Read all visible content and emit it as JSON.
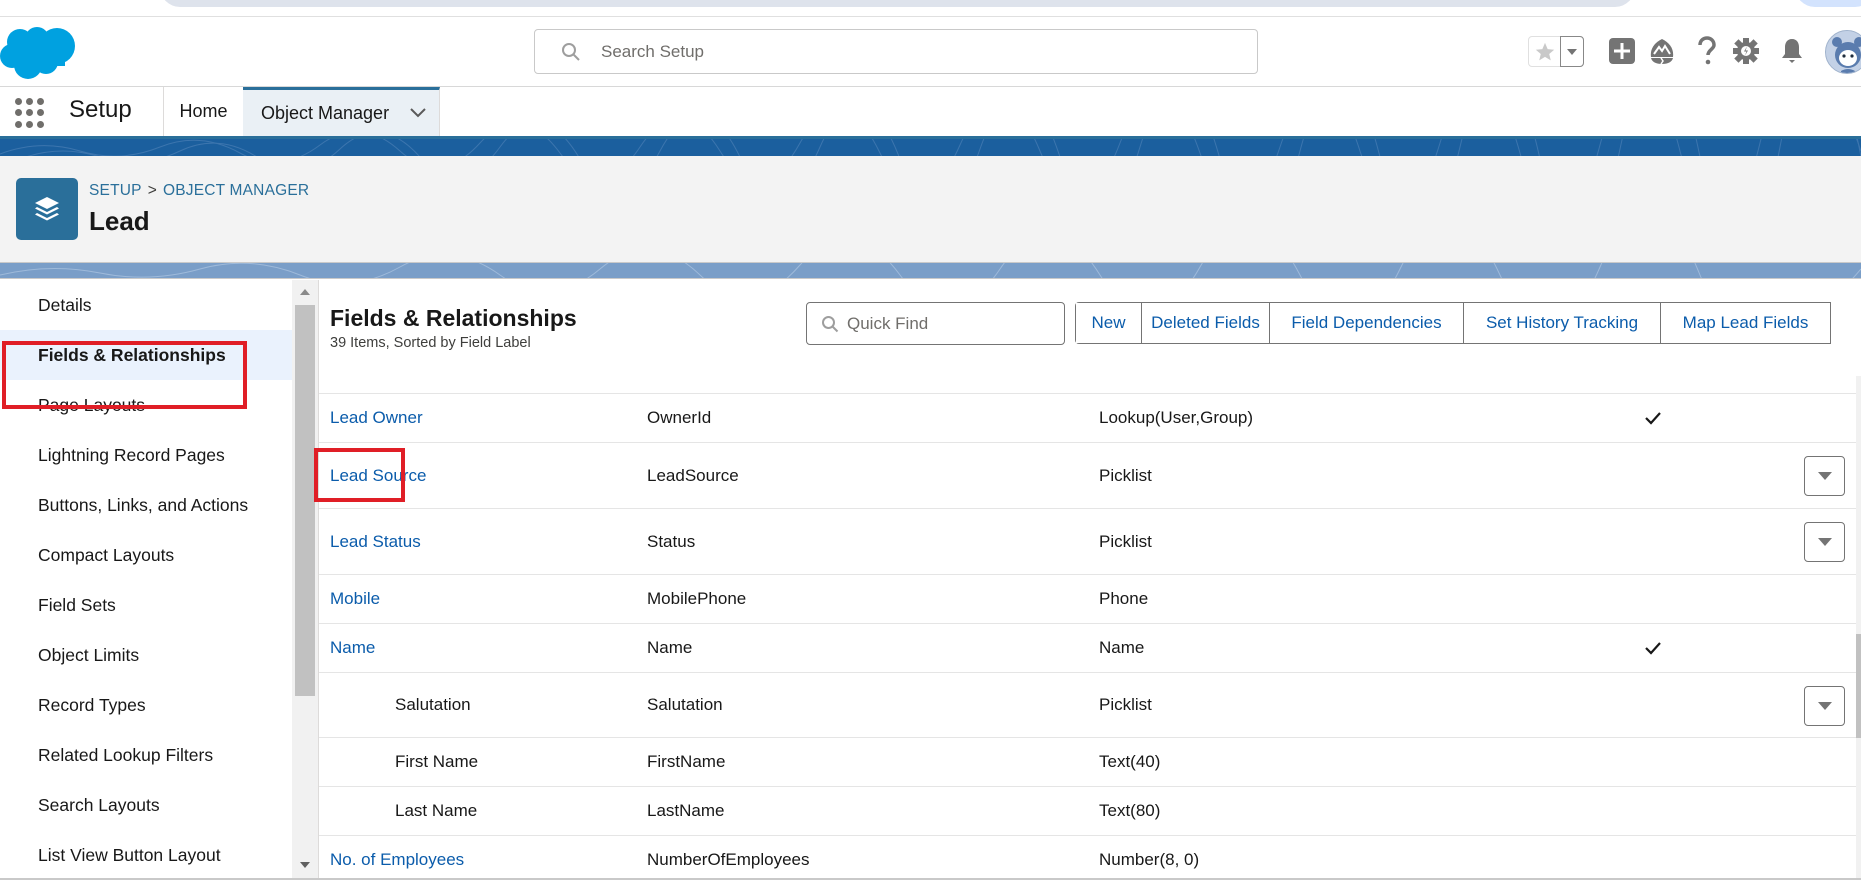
{
  "header": {
    "search_placeholder": "Search Setup",
    "icons": [
      "favorites-star-icon",
      "favorites-dropdown-icon",
      "global-actions-plus-icon",
      "trailhead-icon",
      "help-icon",
      "setup-gear-icon",
      "notifications-bell-icon",
      "user-avatar"
    ]
  },
  "nav": {
    "app_name": "Setup",
    "tabs": [
      {
        "label": "Home",
        "active": false
      },
      {
        "label": "Object Manager",
        "active": true
      }
    ]
  },
  "page_header": {
    "breadcrumb": [
      "SETUP",
      "OBJECT MANAGER"
    ],
    "breadcrumb_separator": ">",
    "title": "Lead"
  },
  "sidebar": {
    "items": [
      {
        "label": "Details",
        "active": false
      },
      {
        "label": "Fields & Relationships",
        "active": true
      },
      {
        "label": "Page Layouts",
        "active": false
      },
      {
        "label": "Lightning Record Pages",
        "active": false
      },
      {
        "label": "Buttons, Links, and Actions",
        "active": false
      },
      {
        "label": "Compact Layouts",
        "active": false
      },
      {
        "label": "Field Sets",
        "active": false
      },
      {
        "label": "Object Limits",
        "active": false
      },
      {
        "label": "Record Types",
        "active": false
      },
      {
        "label": "Related Lookup Filters",
        "active": false
      },
      {
        "label": "Search Layouts",
        "active": false
      },
      {
        "label": "List View Button Layout",
        "active": false
      }
    ]
  },
  "main": {
    "title": "Fields & Relationships",
    "subtitle": "39 Items, Sorted by Field Label",
    "quick_find_placeholder": "Quick Find",
    "buttons": [
      "New",
      "Deleted Fields",
      "Field Dependencies",
      "Set History Tracking",
      "Map Lead Fields"
    ],
    "rows": [
      {
        "label": "Lead Owner",
        "api": "OwnerId",
        "type": "Lookup(User,Group)",
        "indexed": true,
        "has_action": false,
        "link": true,
        "indent": false
      },
      {
        "label": "Lead Source",
        "api": "LeadSource",
        "type": "Picklist",
        "indexed": false,
        "has_action": true,
        "link": true,
        "indent": false
      },
      {
        "label": "Lead Status",
        "api": "Status",
        "type": "Picklist",
        "indexed": false,
        "has_action": true,
        "link": true,
        "indent": false
      },
      {
        "label": "Mobile",
        "api": "MobilePhone",
        "type": "Phone",
        "indexed": false,
        "has_action": false,
        "link": true,
        "indent": false
      },
      {
        "label": "Name",
        "api": "Name",
        "type": "Name",
        "indexed": true,
        "has_action": false,
        "link": true,
        "indent": false
      },
      {
        "label": "Salutation",
        "api": "Salutation",
        "type": "Picklist",
        "indexed": false,
        "has_action": true,
        "link": false,
        "indent": true
      },
      {
        "label": "First Name",
        "api": "FirstName",
        "type": "Text(40)",
        "indexed": false,
        "has_action": false,
        "link": false,
        "indent": true
      },
      {
        "label": "Last Name",
        "api": "LastName",
        "type": "Text(80)",
        "indexed": false,
        "has_action": false,
        "link": false,
        "indent": true
      },
      {
        "label": "No. of Employees",
        "api": "NumberOfEmployees",
        "type": "Number(8, 0)",
        "indexed": false,
        "has_action": false,
        "link": true,
        "indent": false
      }
    ],
    "checkmark_glyph": "✓"
  },
  "annotations": {
    "highlight_color": "#e01e26",
    "highlighted": [
      "sidebar: Fields & Relationships",
      "row: Lead Source"
    ]
  },
  "colors": {
    "brand_blue": "#00a1e0",
    "link_blue": "#0b5cab",
    "header_blue": "#2a6f9a",
    "banner_blue": "#1b5f9e"
  }
}
